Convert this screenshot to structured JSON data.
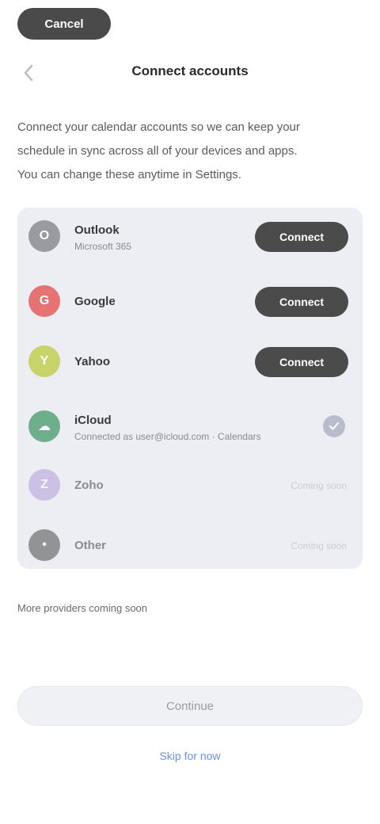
{
  "top_pill": {
    "label": "Cancel"
  },
  "nav": {
    "title": "Connect accounts"
  },
  "intro": {
    "lines": [
      "Connect your calendar accounts so we can keep your",
      "schedule in sync across all of your devices and apps.",
      "You can change these anytime in Settings."
    ]
  },
  "providers": [
    {
      "name": "Outlook",
      "subtitle": "Microsoft 365",
      "action": "Connect",
      "logo_color": "#9a9aa3"
    },
    {
      "name": "Google",
      "subtitle": "",
      "action": "Connect",
      "logo_color": "#e57373"
    },
    {
      "name": "Yahoo",
      "subtitle": "",
      "action": "Connect",
      "logo_color": "#c8d46a"
    },
    {
      "name": "iCloud",
      "subtitle": "Connected as user@icloud.com · Calendars",
      "action": "",
      "logo_color": "#6fae8a"
    },
    {
      "name": "Zoho",
      "subtitle": "",
      "status": "Coming soon",
      "logo_color": "#b39ddb"
    },
    {
      "name": "Other",
      "subtitle": "",
      "status": "Coming soon",
      "logo_color": "#4a4a4a"
    }
  ],
  "footnote": "More providers coming soon",
  "primary_button": {
    "label": "Continue"
  },
  "link_button": {
    "label": "Skip for now"
  },
  "colors": {
    "accent": "#6f8fe6",
    "dark_button": "#4b4b4b",
    "card": "#eceef3"
  }
}
